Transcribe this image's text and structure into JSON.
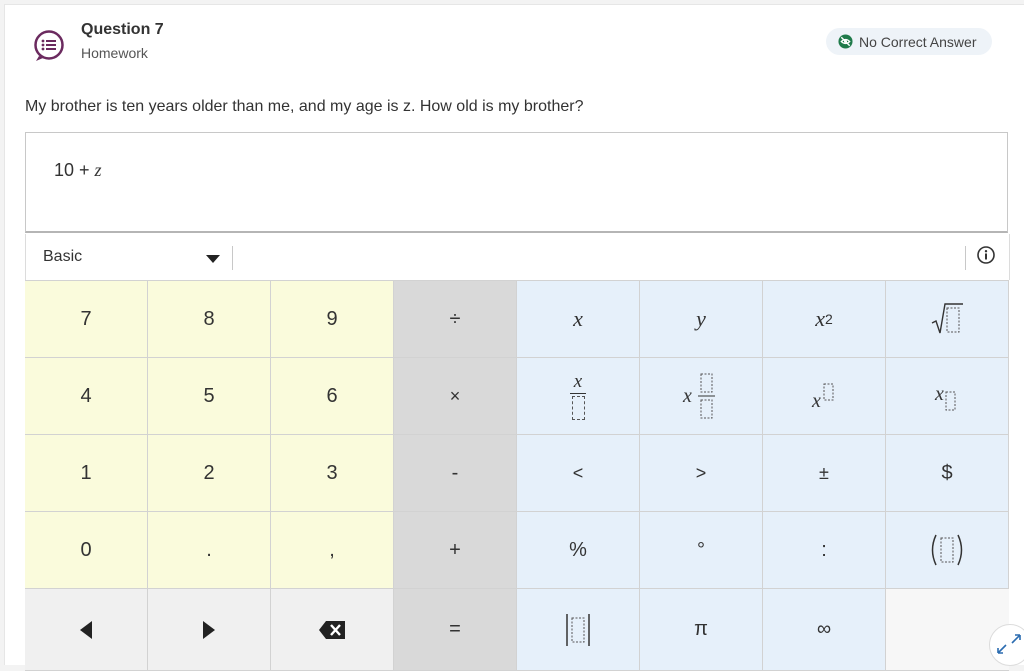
{
  "header": {
    "title": "Question 7",
    "subtitle": "Homework",
    "badge_text": "No Correct Answer",
    "badge_icon": "eye-off-icon"
  },
  "question": {
    "prompt": "My brother is ten years older than me, and my age is z. How old is my brother?"
  },
  "answer": {
    "value_number": "10 + ",
    "value_variable": "z"
  },
  "keyboard": {
    "mode_label": "Basic",
    "info_icon": "info-icon",
    "keys": {
      "seven": "7",
      "eight": "8",
      "nine": "9",
      "divide": "÷",
      "x": "x",
      "y": "y",
      "x_squared_base": "x",
      "x_squared_exp": "2",
      "four": "4",
      "five": "5",
      "six": "6",
      "times": "×",
      "x_over": "x",
      "one": "1",
      "two": "2",
      "three": "3",
      "minus": "-",
      "less": "<",
      "greater": ">",
      "plus_minus": "±",
      "dollar": "$",
      "zero": "0",
      "dot": ".",
      "comma": ",",
      "plus": "+",
      "percent": "%",
      "degree": "°",
      "colon": ":",
      "equals": "=",
      "pi": "π",
      "infinity": "∞"
    }
  },
  "colors": {
    "number_keys": "#fafbdc",
    "operator_keys": "#d9d9d9",
    "variable_keys": "#e6f0fa",
    "accent": "#6b2a5f"
  }
}
